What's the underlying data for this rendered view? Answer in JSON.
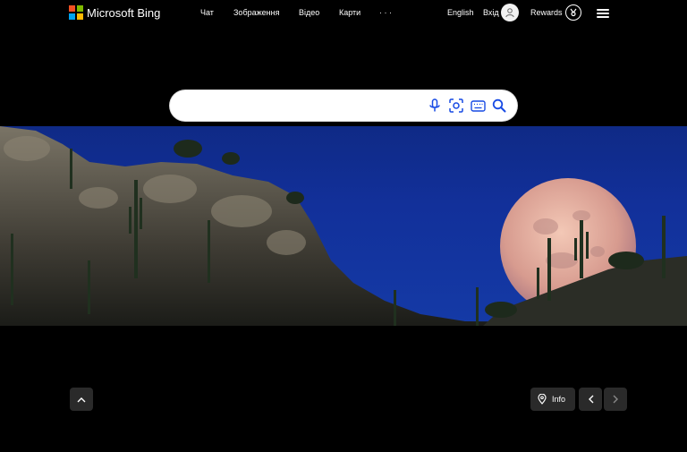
{
  "brand": {
    "name": "Microsoft Bing",
    "logo_colors": [
      "#f25022",
      "#7fba00",
      "#00a4ef",
      "#ffb900"
    ]
  },
  "nav": {
    "items": [
      {
        "label": "Чат"
      },
      {
        "label": "Зображення"
      },
      {
        "label": "Відео"
      },
      {
        "label": "Карти"
      },
      {
        "label": "· · ·"
      }
    ]
  },
  "header_right": {
    "language": "English",
    "sign_in": "Вхід",
    "rewards": "Rewards"
  },
  "search": {
    "value": "",
    "placeholder": "",
    "icons": [
      "microphone-icon",
      "visual-search-icon",
      "keyboard-icon",
      "search-icon"
    ],
    "accent_color": "#174ae4"
  },
  "bottom": {
    "info_label": "Info"
  }
}
